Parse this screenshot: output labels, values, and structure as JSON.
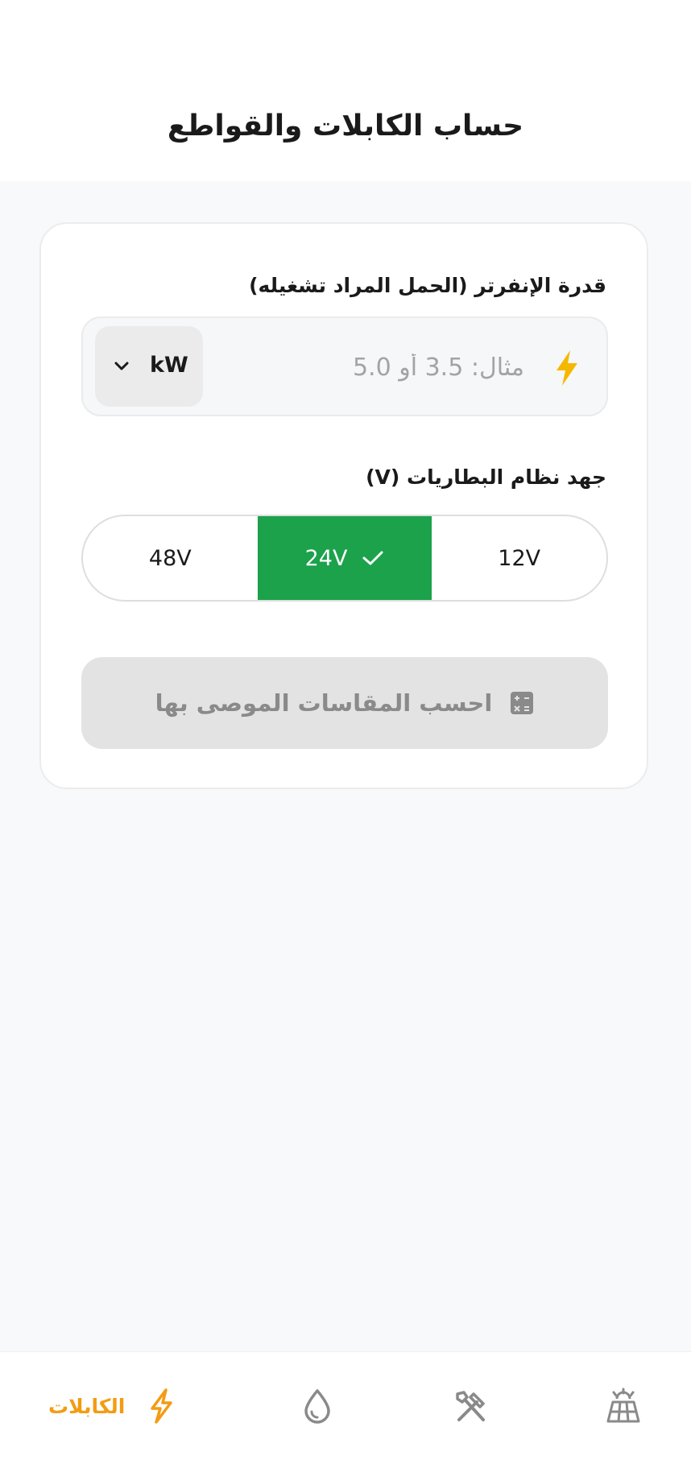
{
  "header": {
    "title": "حساب الكابلات والقواطع"
  },
  "form": {
    "power_label": "قدرة الإنفرتر (الحمل المراد تشغيله)",
    "power_input": {
      "placeholder": "مثال: 3.5 أو 5.0",
      "value": ""
    },
    "unit": {
      "selected": "kW"
    },
    "voltage_label": "جهد نظام البطاريات (V)",
    "voltage_options": [
      {
        "label": "48V",
        "selected": false
      },
      {
        "label": "24V",
        "selected": true
      },
      {
        "label": "12V",
        "selected": false
      }
    ],
    "calculate_button": "احسب المقاسات الموصى بها"
  },
  "bottom_nav": {
    "items": [
      {
        "icon": "lightning-icon",
        "label": "الكابلات",
        "active": true
      },
      {
        "icon": "water-drop-icon",
        "label": "",
        "active": false
      },
      {
        "icon": "tools-icon",
        "label": "",
        "active": false
      },
      {
        "icon": "solar-panel-icon",
        "label": "",
        "active": false
      }
    ]
  },
  "colors": {
    "accent_green": "#1ba24b",
    "accent_orange": "#f39c12",
    "bolt_yellow": "#f5b800",
    "disabled_button": "#e3e3e3"
  }
}
